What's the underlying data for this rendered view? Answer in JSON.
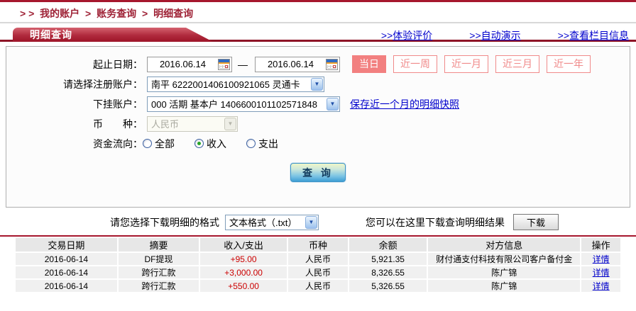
{
  "colors": {
    "accent-red": "#a6172d",
    "ribbon-dark": "#8e1527",
    "breadcrumb-red": "#9e2135",
    "pink": "#f08a8a",
    "link-blue": "#0000cc",
    "amount-red": "#cc0000",
    "select-border": "#7f9db9"
  },
  "breadcrumb": {
    "prefix": "> >",
    "separator": ">",
    "items": [
      "我的账户",
      "账务查询",
      "明细查询"
    ]
  },
  "header": {
    "title": "明细查询",
    "links": [
      {
        "prefix": ">>",
        "label": "体验评价"
      },
      {
        "prefix": ">>",
        "label": "自动演示"
      },
      {
        "prefix": ">>",
        "label": "查看栏目信息"
      }
    ]
  },
  "form": {
    "date_label": "起止日期：",
    "date_from": "2016.06.14",
    "date_to": "2016.06.14",
    "date_separator": "—",
    "quick_buttons": [
      {
        "label": "当日"
      },
      {
        "label": "近一周"
      },
      {
        "label": "近一月"
      },
      {
        "label": "近三月"
      },
      {
        "label": "近一年"
      }
    ],
    "register_label": "请选择注册账户：",
    "register_value": "南平 6222001406100921065 灵通卡",
    "sub_label": "下挂账户：",
    "sub_value": "000 活期 基本户 1406600101102571848",
    "snapshot_link": "保存近一个月的明细快照",
    "currency_label": "币　　种：",
    "currency_value": "人民币",
    "flow_label": "资金流向：",
    "flow_options": [
      {
        "label": "全部"
      },
      {
        "label": "收入"
      },
      {
        "label": "支出"
      }
    ],
    "query_button": "查 询",
    "dropdown_arrow": "▼"
  },
  "download": {
    "format_label": "请您选择下载明细的格式",
    "format_value": "文本格式（.txt）",
    "hint": "您可以在这里下载查询明细结果",
    "button": "下载"
  },
  "table": {
    "headers": [
      "交易日期",
      "摘要",
      "收入/支出",
      "币种",
      "余额",
      "对方信息",
      "操作"
    ],
    "rows": [
      {
        "date": "2016-06-14",
        "summary": "DF提现",
        "amount": "+95.00",
        "currency": "人民币",
        "balance": "5,921.35",
        "counterparty": "财付通支付科技有限公司客户备付金",
        "action": "详情"
      },
      {
        "date": "2016-06-14",
        "summary": "跨行汇款",
        "amount": "+3,000.00",
        "currency": "人民币",
        "balance": "8,326.55",
        "counterparty": "陈广锦",
        "action": "详情"
      },
      {
        "date": "2016-06-14",
        "summary": "跨行汇款",
        "amount": "+550.00",
        "currency": "人民币",
        "balance": "5,326.55",
        "counterparty": "陈广锦",
        "action": "详情"
      }
    ]
  }
}
